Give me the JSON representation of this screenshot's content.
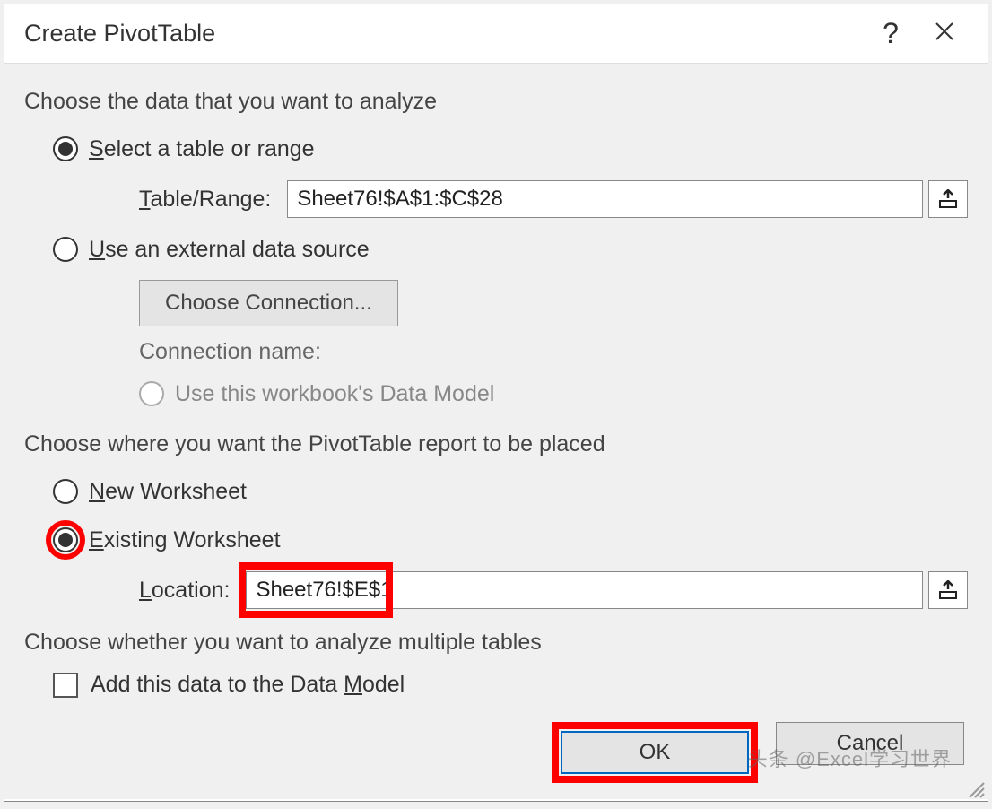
{
  "dialog": {
    "title": "Create PivotTable",
    "help": "?",
    "close": "×"
  },
  "section1": {
    "label": "Choose the data that you want to analyze",
    "opt_select": {
      "prefix": "S",
      "rest": "elect a table or range"
    },
    "table_range_label": {
      "prefix": "T",
      "rest": "able/Range:"
    },
    "table_range_value": "Sheet76!$A$1:$C$28",
    "opt_external": {
      "prefix": "U",
      "rest": "se an external data source"
    },
    "choose_connection": "Choose Connection...",
    "connection_name": "Connection name:",
    "opt_datamodel": "Use this workbook's Data Model"
  },
  "section2": {
    "label": "Choose where you want the PivotTable report to be placed",
    "opt_new": {
      "prefix": "N",
      "rest": "ew Worksheet"
    },
    "opt_existing": {
      "prefix": "E",
      "rest": "xisting Worksheet"
    },
    "location_label": {
      "prefix": "L",
      "rest": "ocation:"
    },
    "location_value": "Sheet76!$E$1"
  },
  "section3": {
    "label": "Choose whether you want to analyze multiple tables",
    "checkbox_label": {
      "pre": "Add this data to the Data ",
      "u": "M",
      "post": "odel"
    }
  },
  "buttons": {
    "ok": "OK",
    "cancel": "Cancel"
  },
  "watermark": "头条 @Excel学习世界"
}
